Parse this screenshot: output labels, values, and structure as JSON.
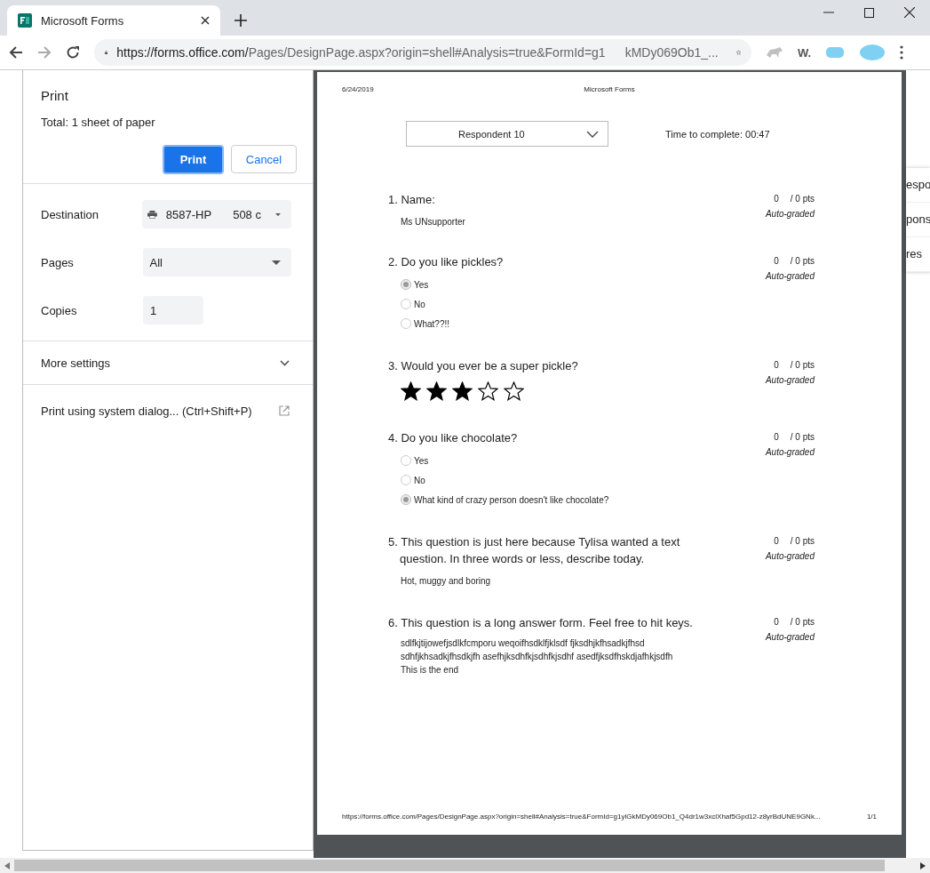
{
  "browser": {
    "tab_title": "Microsoft Forms",
    "url_domain": "https://forms.office.com/",
    "url_path": "Pages/DesignPage.aspx?origin=shell#Analysis=true&FormId=g1",
    "url_tail": "kMDy069Ob1_...",
    "extension_text": "W."
  },
  "print_dialog": {
    "title": "Print",
    "total_label": "Total:",
    "total_value": "1 sheet of paper",
    "print_button": "Print",
    "cancel_button": "Cancel",
    "settings": [
      {
        "kind": "printer",
        "label": "Destination",
        "value_parts": [
          "8587-HP",
          "508 c"
        ]
      },
      {
        "kind": "dropdown",
        "label": "Pages",
        "value": "All"
      },
      {
        "kind": "number",
        "label": "Copies",
        "value": "1"
      }
    ],
    "more_settings": {
      "label": "More settings",
      "expanded": false
    },
    "system_dialog": "Print using system dialog... (Ctrl+Shift+P)"
  },
  "preview": {
    "date": "6/24/2019",
    "header_title": "Microsoft Forms",
    "respondent": "Respondent 10",
    "time_label": "Time to complete: 00:47",
    "questions": [
      {
        "kind": "text",
        "title": "1. Name:",
        "score": "0",
        "max": "/ 0 pts",
        "grading": "Auto-graded",
        "answer": "Ms UNsupporter"
      },
      {
        "kind": "choice",
        "title": "2. Do you like pickles?",
        "score": "0",
        "max": "/ 0 pts",
        "grading": "Auto-graded",
        "options": [
          {
            "label": "Yes",
            "selected": true
          },
          {
            "label": "No",
            "selected": false
          },
          {
            "label": "What??!!",
            "selected": false
          }
        ]
      },
      {
        "kind": "rating",
        "title": "3. Would you ever be a super pickle?",
        "score": "0",
        "max": "/ 0 pts",
        "grading": "Auto-graded",
        "stars": 3
      },
      {
        "kind": "choice",
        "title": "4. Do you like chocolate?",
        "score": "0",
        "max": "/ 0 pts",
        "grading": "Auto-graded",
        "options": [
          {
            "label": "Yes",
            "selected": false
          },
          {
            "label": "No",
            "selected": false
          },
          {
            "label": "What kind of crazy person doesn't like chocolate?",
            "selected": true
          }
        ]
      },
      {
        "kind": "text",
        "title": "5. This question is just here because Tylisa wanted a text question. In three words or less, describe today.",
        "score": "0",
        "max": "/ 0 pts",
        "grading": "Auto-graded",
        "answer": "Hot, muggy and boring"
      },
      {
        "kind": "long",
        "title": "6. This question is a long answer form. Feel free to hit keys.",
        "score": "0",
        "max": "/ 0 pts",
        "grading": "Auto-graded",
        "lines": [
          "sdlfkjtijowefjsdlkfcmporu weqoifhsdklfjklsdf fjksdhjkfhsadkjfhsd",
          "sdhfjkhsadkjfhsdkjfh asefhjksdhfkjsdhfkjsdhf asedfjksdfhskdjafhkjsdfh",
          "This is the end"
        ]
      }
    ],
    "footer_url": "https://forms.office.com/Pages/DesignPage.aspx?origin=shell#Analysis=true&FormId=g1ylGkMDy069Ob1_Q4dr1w3xclXhaf5Gpd12-z8yrBdUNE9GNk...",
    "page_number": "1/1"
  },
  "background_menu": [
    "espo",
    "pons",
    "res"
  ]
}
